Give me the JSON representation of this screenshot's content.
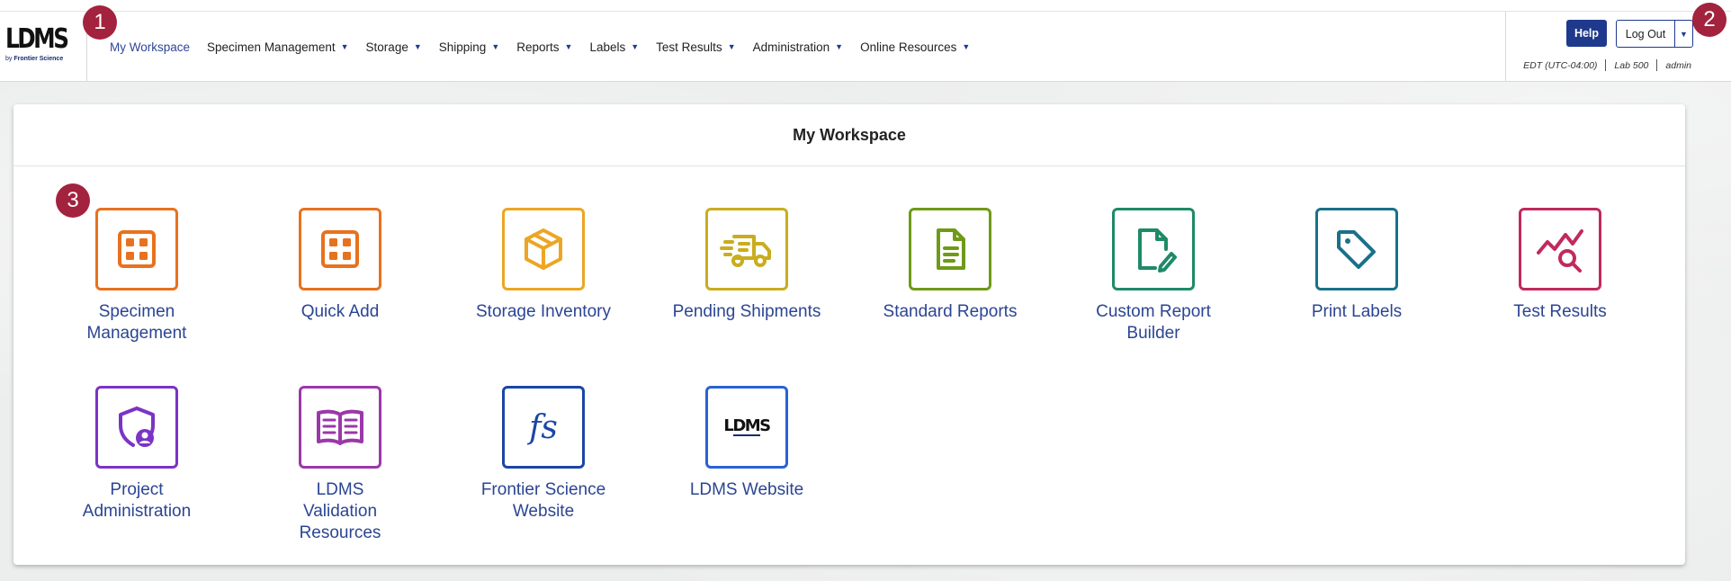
{
  "app": {
    "logo_text": "LDMS",
    "logo_by": "by",
    "logo_company": "Frontier Science"
  },
  "nav": {
    "items": [
      {
        "label": "My Workspace",
        "active": true,
        "dropdown": false
      },
      {
        "label": "Specimen Management",
        "dropdown": true
      },
      {
        "label": "Storage",
        "dropdown": true
      },
      {
        "label": "Shipping",
        "dropdown": true
      },
      {
        "label": "Reports",
        "dropdown": true
      },
      {
        "label": "Labels",
        "dropdown": true
      },
      {
        "label": "Test Results",
        "dropdown": true
      },
      {
        "label": "Administration",
        "dropdown": true
      },
      {
        "label": "Online Resources",
        "dropdown": true
      }
    ],
    "caret": "▼"
  },
  "header_right": {
    "help_label": "Help",
    "logout_label": "Log Out",
    "caret": "▼",
    "timezone": "EDT (UTC-04:00)",
    "lab": "Lab 500",
    "user": "admin"
  },
  "badges": [
    "1",
    "2",
    "3"
  ],
  "workspace": {
    "title": "My Workspace",
    "tiles": [
      {
        "label": "Specimen Management",
        "icon": "grid-icon",
        "color": "#e8711f"
      },
      {
        "label": "Quick Add",
        "icon": "grid-icon",
        "color": "#e8711f"
      },
      {
        "label": "Storage Inventory",
        "icon": "box-icon",
        "color": "#eca624"
      },
      {
        "label": "Pending Shipments",
        "icon": "truck-icon",
        "color": "#c9ad1f"
      },
      {
        "label": "Standard Reports",
        "icon": "document-icon",
        "color": "#6f9a18"
      },
      {
        "label": "Custom Report Builder",
        "icon": "document-edit-icon",
        "color": "#1e8a68"
      },
      {
        "label": "Print Labels",
        "icon": "tag-icon",
        "color": "#1a7189"
      },
      {
        "label": "Test Results",
        "icon": "chart-search-icon",
        "color": "#c12a5b"
      },
      {
        "label": "Project Administration",
        "icon": "shield-user-icon",
        "color": "#7b33c6"
      },
      {
        "label": "LDMS Validation Resources",
        "icon": "book-icon",
        "color": "#9b38a9"
      },
      {
        "label": "Frontier Science Website",
        "icon": "fs-logo-icon",
        "icon_text": "fs",
        "color": "#1c46a6"
      },
      {
        "label": "LDMS Website",
        "icon": "ldms-logo-icon",
        "icon_text": "LDMS",
        "color": "#2a62d6"
      }
    ]
  }
}
